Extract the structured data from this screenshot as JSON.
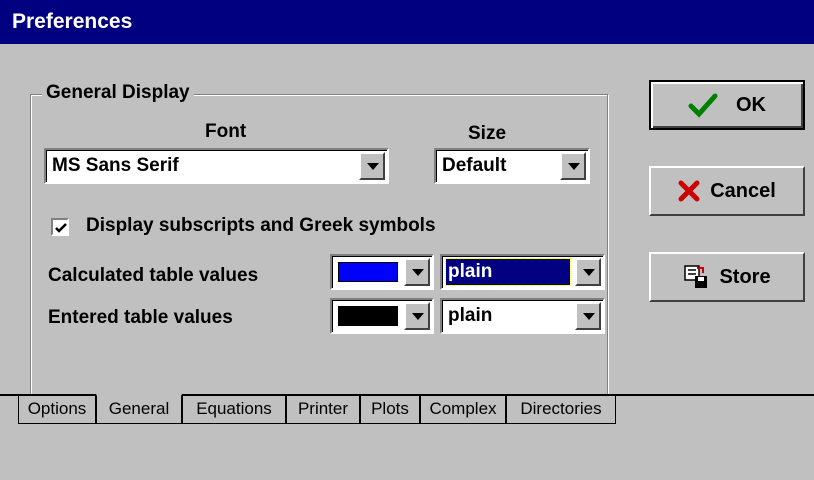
{
  "window": {
    "title": "Preferences"
  },
  "general_display": {
    "legend": "General Display",
    "font_label": "Font",
    "size_label": "Size",
    "font_value": "MS Sans Serif",
    "size_value": "Default",
    "subscripts_label": "Display subscripts and Greek symbols",
    "subscripts_checked": true,
    "calculated_label": "Calculated table values",
    "calculated_color": "#0000ff",
    "calculated_style": "plain",
    "entered_label": "Entered table values",
    "entered_color": "#000000",
    "entered_style": "plain"
  },
  "buttons": {
    "ok": "OK",
    "cancel": "Cancel",
    "store": "Store"
  },
  "tabs": [
    {
      "label": "Options",
      "active": false
    },
    {
      "label": "General",
      "active": true
    },
    {
      "label": "Equations",
      "active": false
    },
    {
      "label": "Printer",
      "active": false
    },
    {
      "label": "Plots",
      "active": false
    },
    {
      "label": "Complex",
      "active": false
    },
    {
      "label": "Directories",
      "active": false
    }
  ],
  "colors": {
    "titlebar": "#000080",
    "face": "#c0c0c0",
    "selection": "#000080"
  },
  "icons": [
    "check-mark-icon",
    "cancel-x-icon",
    "store-disk-icon",
    "dropdown-arrow-icon"
  ]
}
